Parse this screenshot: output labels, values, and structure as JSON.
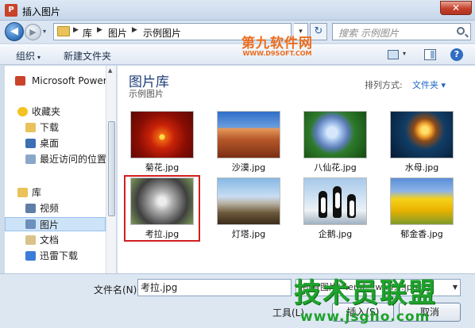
{
  "window": {
    "title": "插入图片",
    "app_icon_letter": "P",
    "close_label": "✕"
  },
  "nav": {
    "back_glyph": "◀",
    "forward_glyph": "▶",
    "breadcrumb": [
      "库",
      "图片",
      "示例图片"
    ],
    "search_placeholder": "搜索 示例图片",
    "refresh_glyph": "↻",
    "history_glyph": "▾",
    "drop_glyph": "▾"
  },
  "toolbar": {
    "organize": "组织",
    "organize_arrow": "▾",
    "new_folder": "新建文件夹",
    "help": "?",
    "view_arrow": "▾"
  },
  "sidebar": {
    "items": [
      {
        "label": "Microsoft PowerPoint",
        "icon": "powerpoint-icon",
        "color": "#c9422a"
      },
      {
        "label": "收藏夹",
        "icon": "star-icon",
        "color": "#f2c322"
      },
      {
        "label": "下载",
        "icon": "download-folder-icon",
        "color": "#e9c25a"
      },
      {
        "label": "桌面",
        "icon": "desktop-icon",
        "color": "#3d6fb3"
      },
      {
        "label": "最近访问的位置",
        "icon": "recent-places-icon",
        "color": "#8aa7c9"
      },
      {
        "label": "库",
        "icon": "library-icon",
        "color": "#e9c25a"
      },
      {
        "label": "视频",
        "icon": "video-library-icon",
        "color": "#5f7ea8"
      },
      {
        "label": "图片",
        "icon": "pictures-library-icon",
        "color": "#6d8fbc"
      },
      {
        "label": "文档",
        "icon": "documents-library-icon",
        "color": "#d9c38a"
      },
      {
        "label": "迅雷下载",
        "icon": "thunder-download-icon",
        "color": "#3b7dd8"
      }
    ]
  },
  "main": {
    "library_title": "图片库",
    "library_subtitle": "示例图片",
    "arrange_label": "排列方式:",
    "arrange_value": "文件夹 ▾",
    "files": [
      {
        "name": "菊花.jpg",
        "thumb": "chrysanthemum"
      },
      {
        "name": "沙漠.jpg",
        "thumb": "desert"
      },
      {
        "name": "八仙花.jpg",
        "thumb": "hydrangea"
      },
      {
        "name": "水母.jpg",
        "thumb": "jellyfish"
      },
      {
        "name": "考拉.jpg",
        "thumb": "koala",
        "selected": true
      },
      {
        "name": "灯塔.jpg",
        "thumb": "lighthouse"
      },
      {
        "name": "企鹅.jpg",
        "thumb": "penguins"
      },
      {
        "name": "郁金香.jpg",
        "thumb": "tulips"
      }
    ]
  },
  "bottom": {
    "filename_label": "文件名(N):",
    "filename_value": "考拉.jpg",
    "filter_value": "所有图片(*.emf;*.wmf;*.jpg;*.j",
    "tools_label": "工具(L)",
    "insert_label": "插入(S)",
    "cancel_label": "取消"
  },
  "watermarks": {
    "top_main": "第九软件网",
    "top_sub": "WWW.D9SOFT.COM",
    "bottom_main": "技术员联盟",
    "bottom_url": "www.jsgho.com"
  }
}
